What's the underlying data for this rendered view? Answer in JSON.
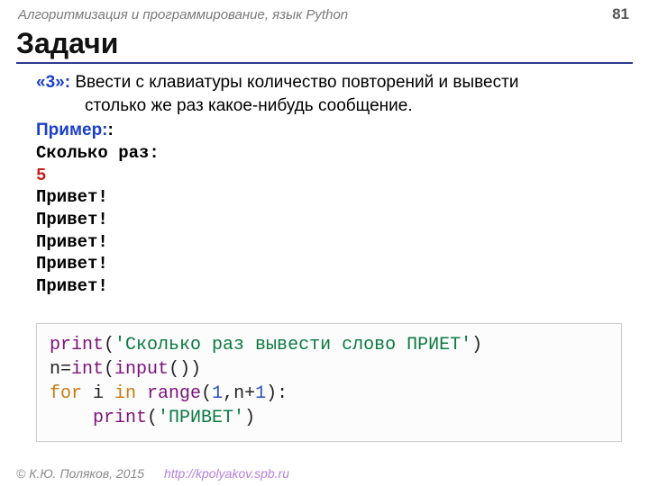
{
  "header": {
    "course_title": "Алгоритмизация и программирование, язык Python",
    "page_number": "81"
  },
  "title": "Задачи",
  "task": {
    "label": "«3»:",
    "text_line1": "Ввести с клавиатуры количество повторений и вывести",
    "text_line2": "столько же раз какое-нибудь сообщение."
  },
  "example": {
    "label": "Пример:",
    "prompt": "Сколько раз:",
    "input_value": "5",
    "outputs": [
      "Привет!",
      "Привет!",
      "Привет!",
      "Привет!",
      "Привет!"
    ]
  },
  "code": {
    "print1_fn": "print",
    "print1_str": "'Сколько раз вывести слово ПРИЕТ'",
    "assign_lhs": "n=",
    "int_fn": "int",
    "input_fn": "input",
    "for_kw": "for",
    "for_mid": " i ",
    "in_kw": "in",
    "range_fn": " range",
    "range_arg_num": "1",
    "range_arg_rest": ",n+",
    "range_arg_one": "1",
    "print2_fn": "print",
    "print2_str": "'ПРИВЕТ'"
  },
  "footer": {
    "copyright": "© К.Ю. Поляков, 2015",
    "url": "http://kpolyakov.spb.ru"
  }
}
